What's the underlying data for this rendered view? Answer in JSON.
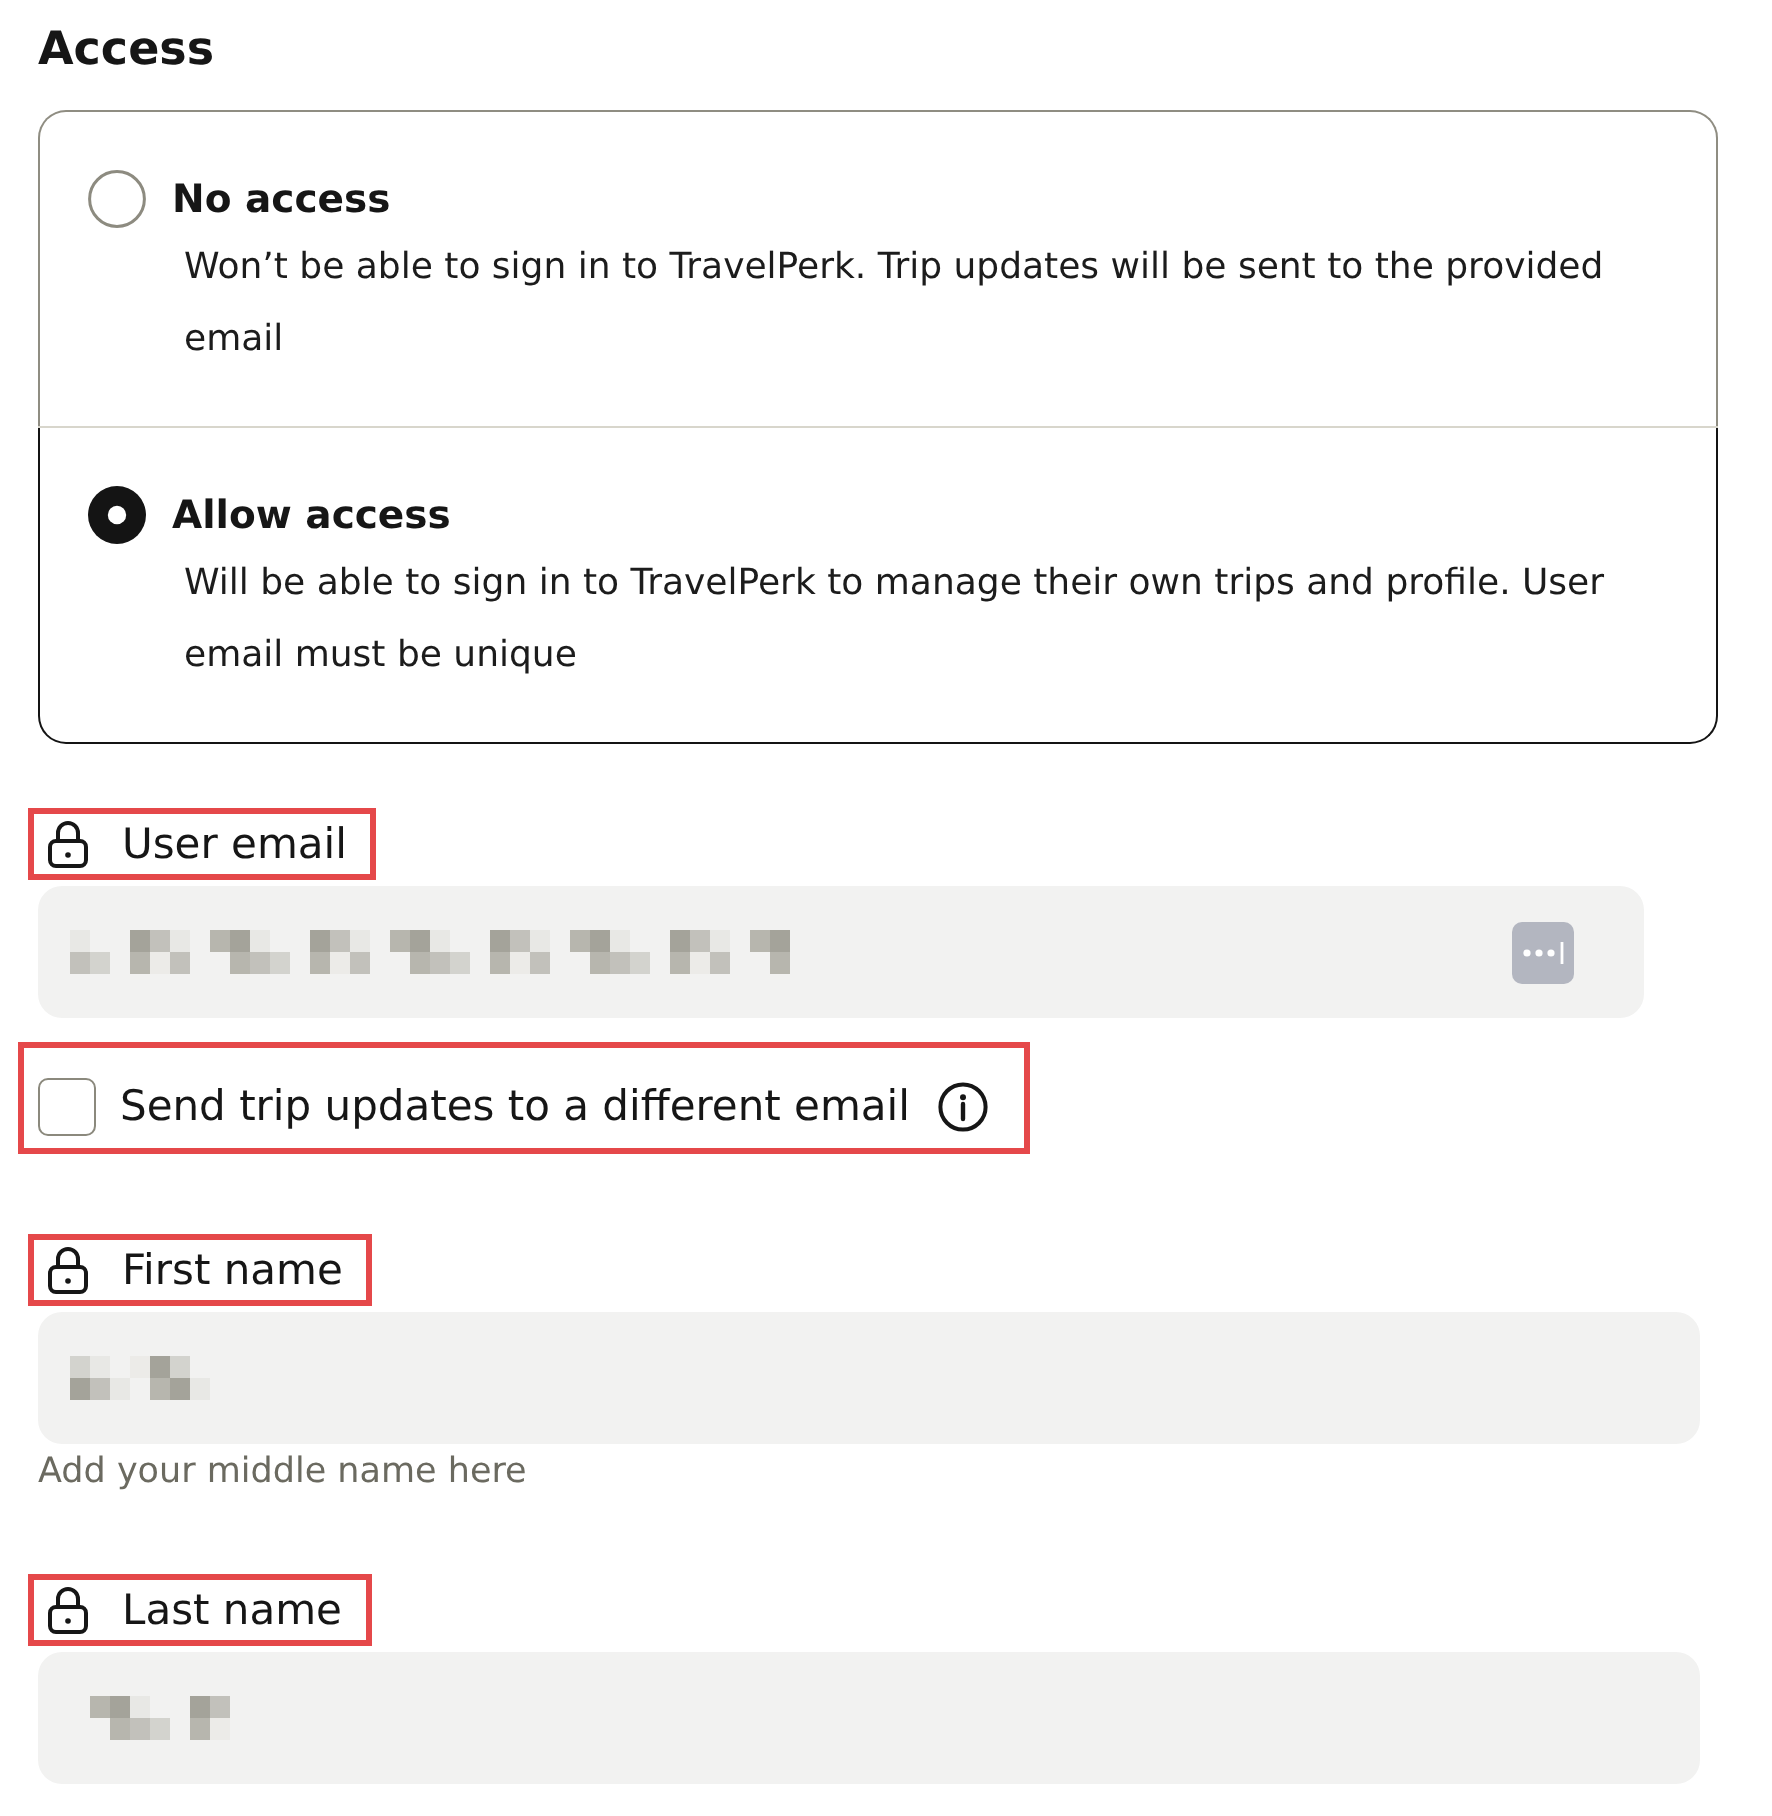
{
  "section_title": "Access",
  "access_options": [
    {
      "label": "No access",
      "description": "Won’t be able to sign in to TravelPerk. Trip updates will be sent to the provided email",
      "selected": false
    },
    {
      "label": "Allow access",
      "description": "Will be able to sign in to TravelPerk to manage their own trips and profile. User email must be unique",
      "selected": true
    }
  ],
  "fields": [
    {
      "kind": "email",
      "label": "User email",
      "locked": true,
      "highlighted": true,
      "redacted": true
    },
    {
      "kind": "checkbox",
      "label": "Send trip updates to a different email",
      "checked": false,
      "highlighted": true
    },
    {
      "kind": "text",
      "label": "First name",
      "locked": true,
      "highlighted": true,
      "redacted": true,
      "helper": "Add your middle name here"
    },
    {
      "kind": "text",
      "label": "Last name",
      "locked": true,
      "highlighted": true,
      "redacted": true
    }
  ]
}
